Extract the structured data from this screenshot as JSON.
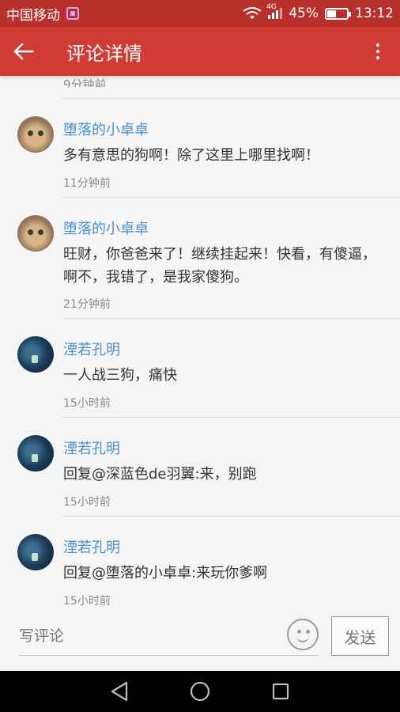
{
  "status_bar": {
    "carrier": "中国移动",
    "network": "4G",
    "battery_percent": "45%",
    "battery_level": 0.45,
    "time": "13:12"
  },
  "app_bar": {
    "title": "评论详情"
  },
  "peek": {
    "time": "9分钟前"
  },
  "comments": [
    {
      "author": "堕落的小卓卓",
      "text": "多有意思的狗啊！除了这里上哪里找啊！",
      "time": "11分钟前",
      "avatar": "cat-avatar"
    },
    {
      "author": "堕落的小卓卓",
      "text": "旺财，你爸爸来了！继续挂起来！快看，有傻逼，啊不，我错了，是我家傻狗。",
      "time": "21分钟前",
      "avatar": "cat-avatar"
    },
    {
      "author": "湮若孔明",
      "text": "一人战三狗，痛快",
      "time": "15小时前",
      "avatar": "space-avatar"
    },
    {
      "author": "湮若孔明",
      "text": "回复@深蓝色de羽翼:来，别跑",
      "time": "15小时前",
      "avatar": "space-avatar"
    },
    {
      "author": "湮若孔明",
      "text": "回复@堕落的小卓卓:来玩你爹啊",
      "time": "15小时前",
      "avatar": "space-avatar"
    }
  ],
  "input_bar": {
    "placeholder": "写评论",
    "value": "",
    "send_label": "发送"
  },
  "colors": {
    "status_bar": "#b8302b",
    "app_bar": "#d03c35",
    "author_name": "#4a90c8"
  },
  "icons": [
    "back-arrow-icon",
    "more-vert-icon",
    "wifi-icon",
    "signal-icon",
    "battery-icon",
    "emoji-icon",
    "nav-back-icon",
    "nav-home-icon",
    "nav-recents-icon"
  ]
}
